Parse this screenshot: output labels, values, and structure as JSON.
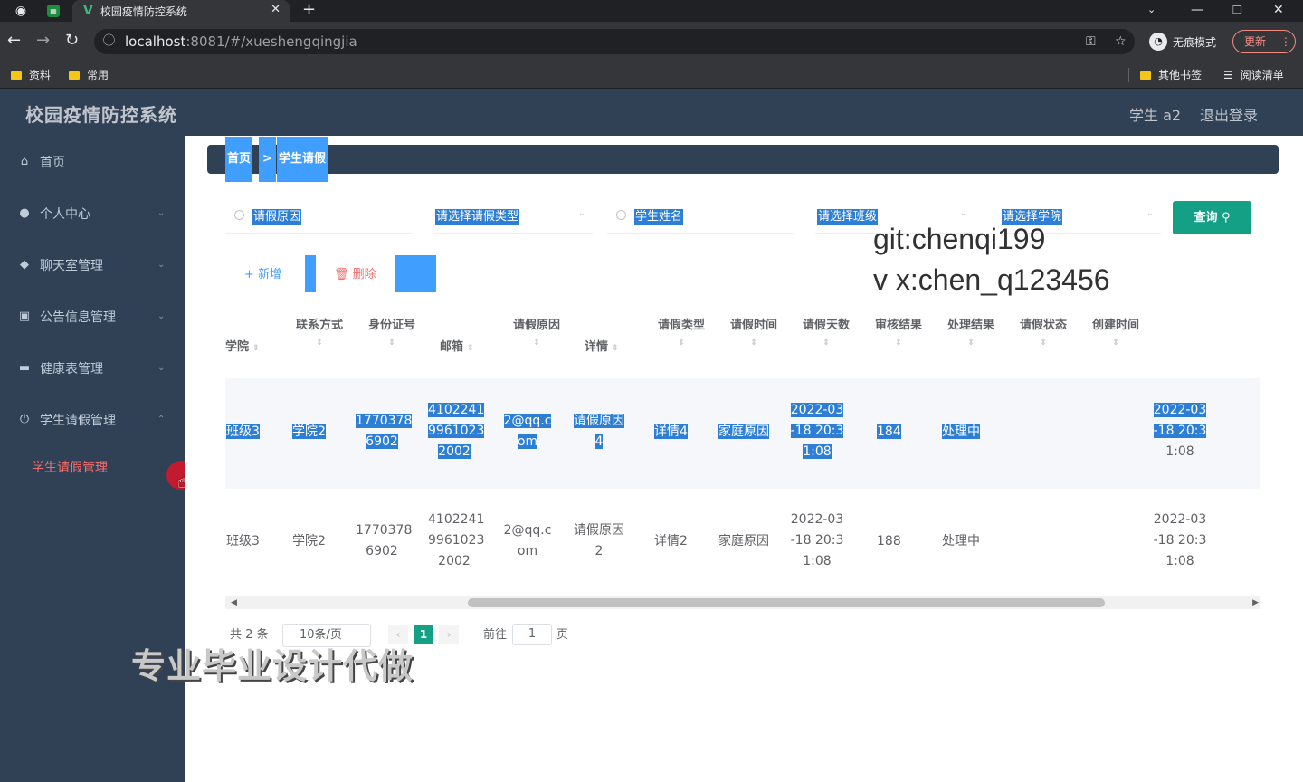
{
  "browser": {
    "tab_title": "校园疫情防控系统",
    "url_host": "localhost",
    "url_path": ":8081/#/xueshengqingjia",
    "incognito_label": "无痕模式",
    "update_label": "更新",
    "bookmarks": [
      "资料",
      "常用"
    ],
    "bookmarks_right": [
      "其他书签",
      "阅读清单"
    ]
  },
  "app": {
    "title": "校园疫情防控系统",
    "user": "学生 a2",
    "logout": "退出登录"
  },
  "sidebar": {
    "items": [
      {
        "label": "首页",
        "icon": "home-icon"
      },
      {
        "label": "个人中心",
        "icon": "user-icon"
      },
      {
        "label": "聊天室管理",
        "icon": "chat-icon"
      },
      {
        "label": "公告信息管理",
        "icon": "notice-icon"
      },
      {
        "label": "健康表管理",
        "icon": "health-icon"
      },
      {
        "label": "学生请假管理",
        "icon": "power-icon"
      }
    ],
    "sub_item": "学生请假管理"
  },
  "breadcrumb": {
    "home": "首页",
    "sep": ">",
    "current": "学生请假"
  },
  "filters": {
    "reason": "请假原因",
    "leave_type": "请选择请假类型",
    "student_name": "学生姓名",
    "class": "请选择班级",
    "college": "请选择学院",
    "query": "查询"
  },
  "watermark": {
    "git": "git:chenqi199",
    "wx": "v x:chen_q123456",
    "ad": "专业毕业设计代做"
  },
  "actions": {
    "add": "新增",
    "delete": "删除"
  },
  "table": {
    "headers": [
      "学院",
      "联系方式",
      "身份证号",
      "邮箱",
      "请假原因",
      "详情",
      "请假类型",
      "请假时间",
      "请假天数",
      "审核结果",
      "处理结果",
      "请假状态",
      "创建时间"
    ],
    "rows": [
      {
        "class": "班级3",
        "college": "学院2",
        "phone": [
          "1770378",
          "6902"
        ],
        "idcard": [
          "4102241",
          "9961023",
          "2002"
        ],
        "email": [
          "2@qq.c",
          "om"
        ],
        "reason": [
          "请假原因",
          "4"
        ],
        "detail": "详情4",
        "type": "家庭原因",
        "time": [
          "2022-03",
          "-18 20:3",
          "1:08"
        ],
        "days": "184",
        "result": "处理中",
        "created": [
          "2022-03",
          "-18 20:3",
          "1:08"
        ]
      },
      {
        "class": "班级3",
        "college": "学院2",
        "phone": [
          "1770378",
          "6902"
        ],
        "idcard": [
          "4102241",
          "9961023",
          "2002"
        ],
        "email": [
          "2@qq.c",
          "om"
        ],
        "reason": [
          "请假原因",
          "2"
        ],
        "detail": "详情2",
        "type": "家庭原因",
        "time": [
          "2022-03",
          "-18 20:3",
          "1:08"
        ],
        "days": "188",
        "result": "处理中",
        "created": [
          "2022-03",
          "-18 20:3",
          "1:08"
        ]
      }
    ]
  },
  "pagination": {
    "total": "共 2 条",
    "size": "10条/页",
    "current": "1",
    "goto": "前往",
    "page_input": "1",
    "page_suffix": "页"
  }
}
